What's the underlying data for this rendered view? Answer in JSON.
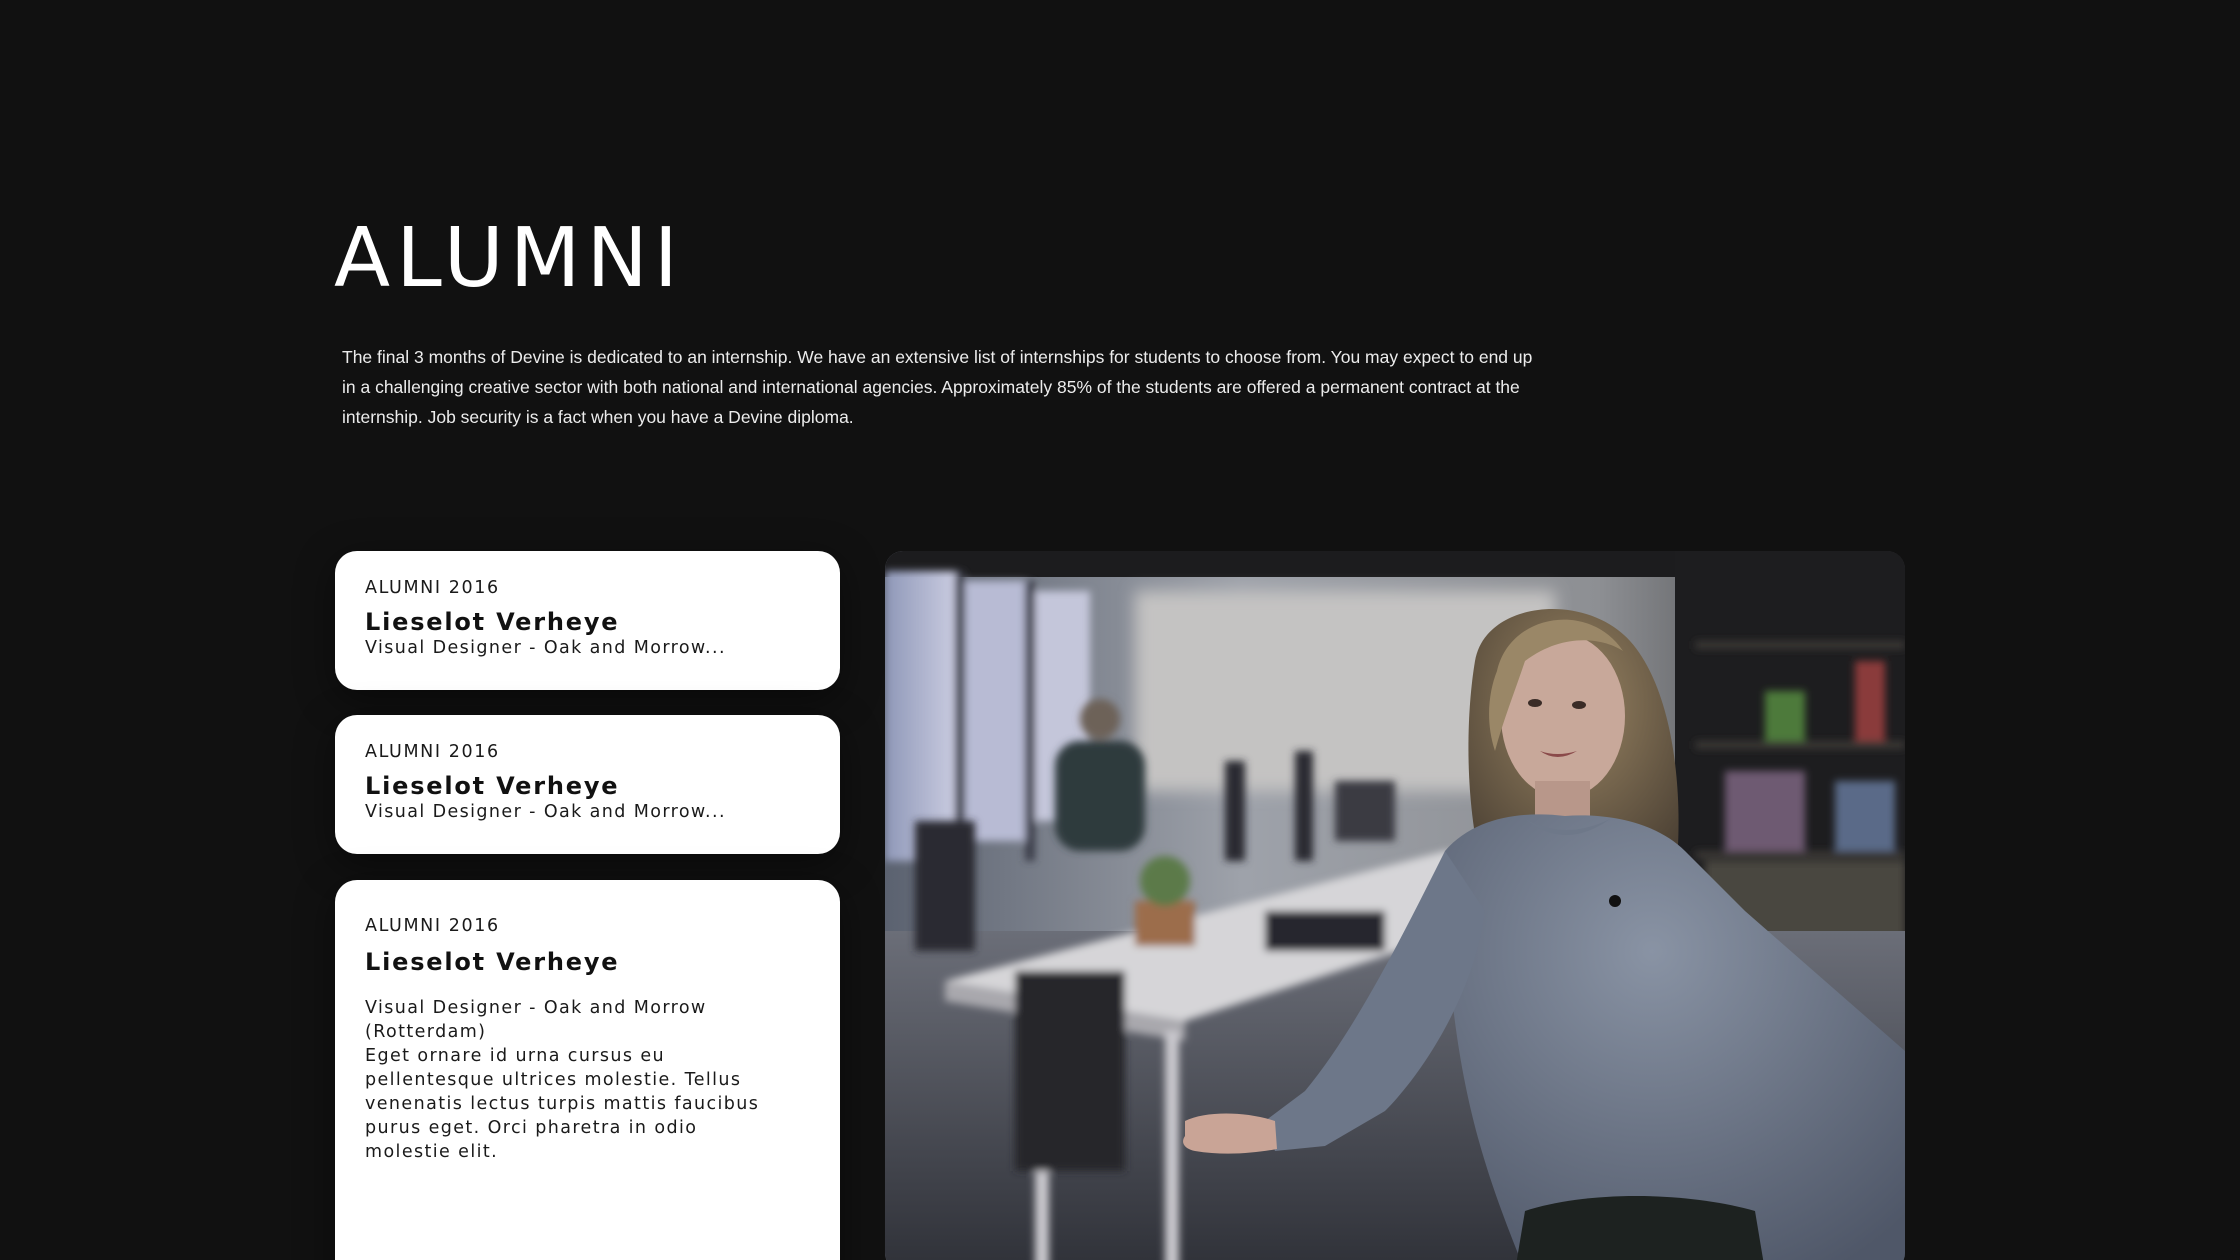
{
  "page": {
    "title": "ALUMNI",
    "intro": "The final 3 months of Devine is dedicated to an internship. We have an extensive list of internships for students to choose from. You may expect to end up in a challenging creative sector with both national and international agencies. Approximately 85% of the students are offered a permanent contract at the internship. Job security is a fact when you have a Devine diploma."
  },
  "alumni": [
    {
      "label": "ALUMNI 2016",
      "name": "Lieselot Verheye",
      "role": "Visual Designer - Oak and Morrow..."
    },
    {
      "label": "ALUMNI 2016",
      "name": "Lieselot Verheye",
      "role": "Visual Designer - Oak and Morrow..."
    },
    {
      "label": "ALUMNI 2016",
      "name": "Lieselot Verheye",
      "role": "Visual Designer - Oak and Morrow (Rotterdam)",
      "description": "Eget ornare id urna cursus eu pellentesque ultrices molestie. Tellus venenatis lectus turpis mattis faucibus purus eget. Orci pharetra in odio molestie elit."
    }
  ],
  "colors": {
    "background": "#111111",
    "card": "#ffffff",
    "text_light": "#ffffff",
    "text_dark": "#111111"
  }
}
